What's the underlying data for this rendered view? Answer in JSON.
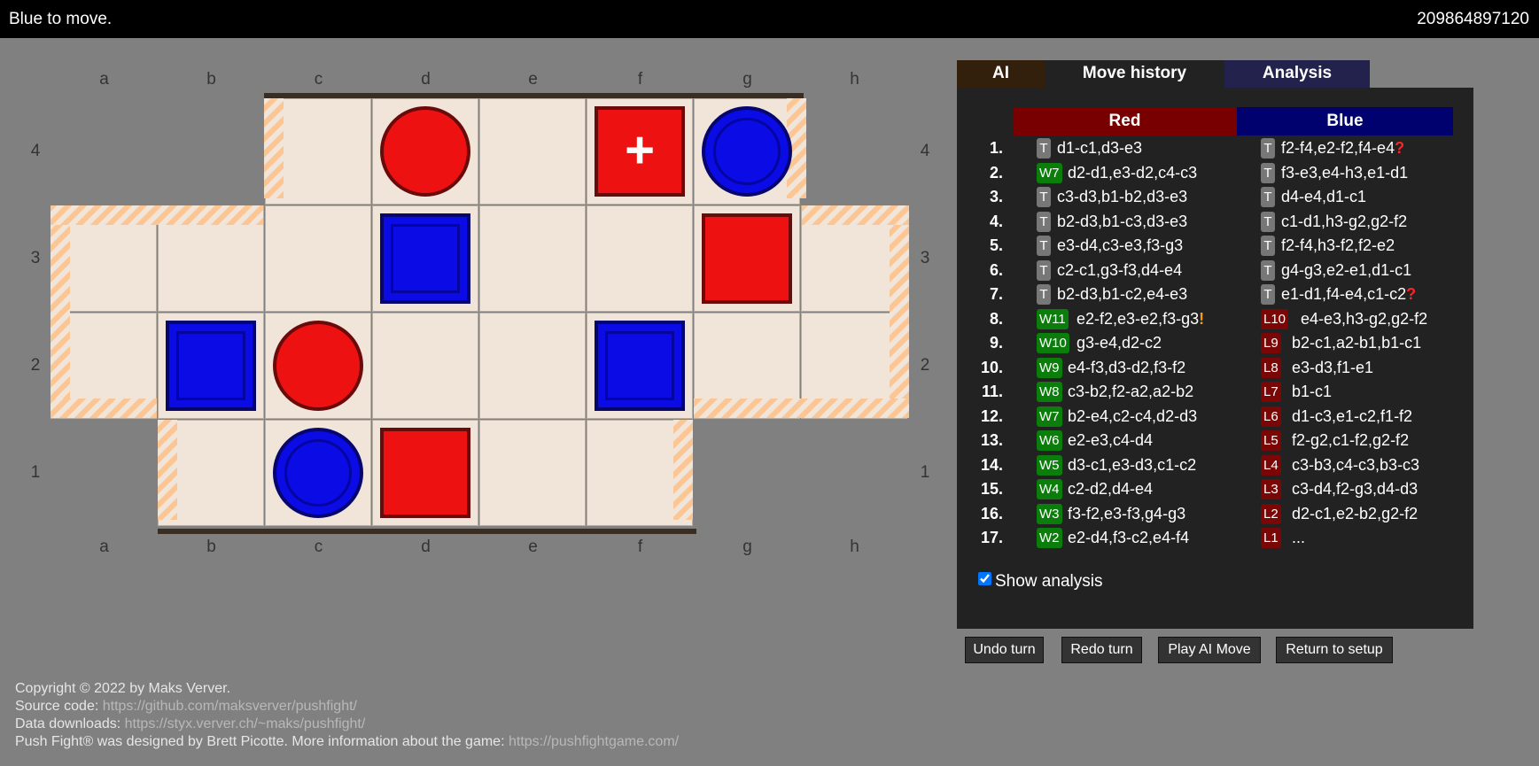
{
  "header": {
    "status": "Blue to move.",
    "game_id": "209864897120"
  },
  "board": {
    "files": [
      "a",
      "b",
      "c",
      "d",
      "e",
      "f",
      "g",
      "h"
    ],
    "ranks": [
      "4",
      "3",
      "2",
      "1"
    ],
    "pieces": [
      {
        "square": "d4",
        "color": "red",
        "shape": "pusher-circle"
      },
      {
        "square": "f4",
        "color": "red",
        "shape": "square",
        "anchor": true,
        "anchor_glyph": "+"
      },
      {
        "square": "g4",
        "color": "blue",
        "shape": "pusher-circle"
      },
      {
        "square": "d3",
        "color": "blue",
        "shape": "square"
      },
      {
        "square": "g3",
        "color": "red",
        "shape": "square"
      },
      {
        "square": "b2",
        "color": "blue",
        "shape": "square"
      },
      {
        "square": "c2",
        "color": "red",
        "shape": "pusher-circle"
      },
      {
        "square": "f2",
        "color": "blue",
        "shape": "square"
      },
      {
        "square": "c1",
        "color": "blue",
        "shape": "pusher-circle"
      },
      {
        "square": "d1",
        "color": "red",
        "shape": "square"
      }
    ]
  },
  "tabs": {
    "ai": "AI",
    "history": "Move history",
    "analysis": "Analysis"
  },
  "history": {
    "red_header": "Red",
    "blue_header": "Blue",
    "moves": [
      {
        "num": "1.",
        "red": {
          "tag": "T",
          "text": "d1-c1,d3-e3"
        },
        "blue": {
          "tag": "T",
          "text": "f2-f4,e2-f2,f4-e4",
          "mark": "?"
        }
      },
      {
        "num": "2.",
        "red": {
          "tag": "W7",
          "text": "d2-d1,e3-d2,c4-c3"
        },
        "blue": {
          "tag": "T",
          "text": "f3-e3,e4-h3,e1-d1"
        }
      },
      {
        "num": "3.",
        "red": {
          "tag": "T",
          "text": "c3-d3,b1-b2,d3-e3"
        },
        "blue": {
          "tag": "T",
          "text": "d4-e4,d1-c1"
        }
      },
      {
        "num": "4.",
        "red": {
          "tag": "T",
          "text": "b2-d3,b1-c3,d3-e3"
        },
        "blue": {
          "tag": "T",
          "text": "c1-d1,h3-g2,g2-f2"
        }
      },
      {
        "num": "5.",
        "red": {
          "tag": "T",
          "text": "e3-d4,c3-e3,f3-g3"
        },
        "blue": {
          "tag": "T",
          "text": "f2-f4,h3-f2,f2-e2"
        }
      },
      {
        "num": "6.",
        "red": {
          "tag": "T",
          "text": "c2-c1,g3-f3,d4-e4"
        },
        "blue": {
          "tag": "T",
          "text": "g4-g3,e2-e1,d1-c1"
        }
      },
      {
        "num": "7.",
        "red": {
          "tag": "T",
          "text": "b2-d3,b1-c2,e4-e3"
        },
        "blue": {
          "tag": "T",
          "text": "e1-d1,f4-e4,c1-c2",
          "mark": "?"
        }
      },
      {
        "num": "8.",
        "red": {
          "tag": "W11",
          "text": "e2-f2,e3-e2,f3-g3",
          "mark": "!"
        },
        "blue": {
          "tag": "L10",
          "text": "e4-e3,h3-g2,g2-f2"
        }
      },
      {
        "num": "9.",
        "red": {
          "tag": "W10",
          "text": "g3-e4,d2-c2"
        },
        "blue": {
          "tag": "L9",
          "text": "b2-c1,a2-b1,b1-c1"
        }
      },
      {
        "num": "10.",
        "red": {
          "tag": "W9",
          "text": "e4-f3,d3-d2,f3-f2"
        },
        "blue": {
          "tag": "L8",
          "text": "e3-d3,f1-e1"
        }
      },
      {
        "num": "11.",
        "red": {
          "tag": "W8",
          "text": "c3-b2,f2-a2,a2-b2"
        },
        "blue": {
          "tag": "L7",
          "text": "b1-c1"
        }
      },
      {
        "num": "12.",
        "red": {
          "tag": "W7",
          "text": "b2-e4,c2-c4,d2-d3"
        },
        "blue": {
          "tag": "L6",
          "text": "d1-c3,e1-c2,f1-f2"
        }
      },
      {
        "num": "13.",
        "red": {
          "tag": "W6",
          "text": "e2-e3,c4-d4"
        },
        "blue": {
          "tag": "L5",
          "text": "f2-g2,c1-f2,g2-f2"
        }
      },
      {
        "num": "14.",
        "red": {
          "tag": "W5",
          "text": "d3-c1,e3-d3,c1-c2"
        },
        "blue": {
          "tag": "L4",
          "text": "c3-b3,c4-c3,b3-c3"
        }
      },
      {
        "num": "15.",
        "red": {
          "tag": "W4",
          "text": "c2-d2,d4-e4"
        },
        "blue": {
          "tag": "L3",
          "text": "c3-d4,f2-g3,d4-d3"
        }
      },
      {
        "num": "16.",
        "red": {
          "tag": "W3",
          "text": "f3-f2,e3-f3,g4-g3"
        },
        "blue": {
          "tag": "L2",
          "text": "d2-c1,e2-b2,g2-f2"
        }
      },
      {
        "num": "17.",
        "red": {
          "tag": "W2",
          "text": "e2-d4,f3-c2,e4-f4"
        },
        "blue": {
          "tag": "L1",
          "text": "..."
        }
      }
    ],
    "show_analysis_label": "Show analysis",
    "show_analysis_checked": true
  },
  "buttons": {
    "undo": "Undo turn",
    "redo": "Redo turn",
    "play_ai": "Play AI Move",
    "return_setup": "Return to setup"
  },
  "footer": {
    "copyright": "Copyright © 2022 by Maks Verver.",
    "source_label": "Source code:",
    "source_url": "https://github.com/maksverver/pushfight/",
    "data_label": "Data downloads:",
    "data_url": "https://styx.verver.ch/~maks/pushfight/",
    "designed_text": "Push Fight® was designed by Brett Picotte. More information about the game:",
    "game_url": "https://pushfightgame.com/"
  }
}
